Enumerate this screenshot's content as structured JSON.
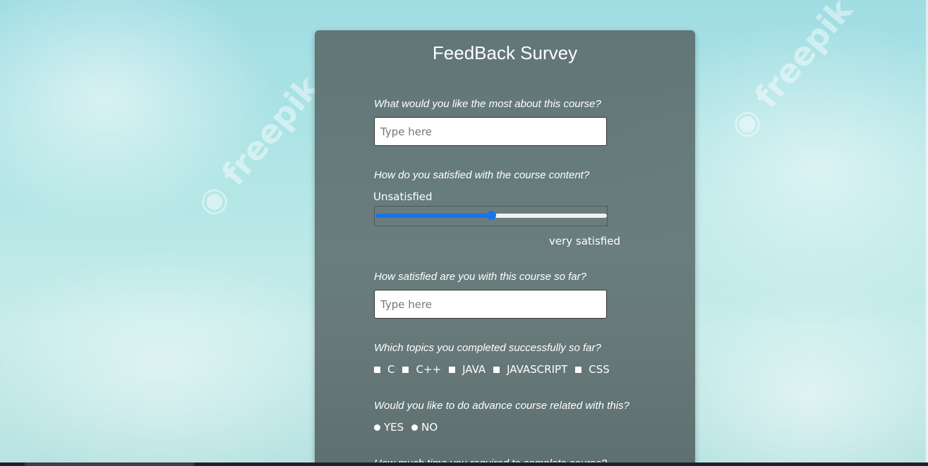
{
  "survey": {
    "title": "FeedBack Survey",
    "q1": {
      "label": "What would you like the most about this course?",
      "placeholder": "Type here",
      "value": ""
    },
    "q2": {
      "label": "How do you satisfied with the course content?",
      "min_label": "Unsatisfied",
      "max_label": "very satisfied",
      "value_fraction": 0.5
    },
    "q3": {
      "label": "How satisfied are you with this course so far?",
      "placeholder": "Type here",
      "value": ""
    },
    "q4": {
      "label": "Which topics you completed successfully so far?",
      "options": [
        "C",
        "C++",
        "JAVA",
        "JAVASCRIPT",
        "CSS"
      ]
    },
    "q5": {
      "label": "Would you like to do advance course related with this?",
      "options": [
        "YES",
        "NO"
      ]
    },
    "q6": {
      "label": "How much time you required to complete course?"
    }
  },
  "colors": {
    "accent": "#1a73e8",
    "card": "#5a6a6a",
    "text": "#ffffff"
  }
}
